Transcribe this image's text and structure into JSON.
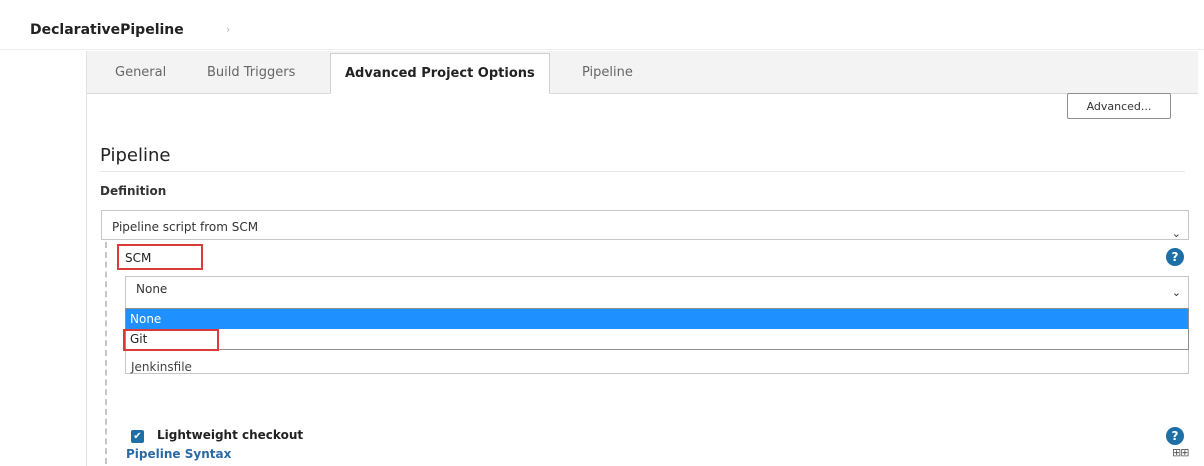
{
  "breadcrumb": {
    "project": "DeclarativePipeline",
    "arrow": "›"
  },
  "tabs": [
    {
      "label": "General"
    },
    {
      "label": "Build Triggers"
    },
    {
      "label": "Advanced Project Options"
    },
    {
      "label": "Pipeline"
    }
  ],
  "advanced_button": "Advanced...",
  "section": {
    "title": "Pipeline",
    "definition_label": "Definition",
    "definition_value": "Pipeline script from SCM"
  },
  "scm": {
    "label": "SCM",
    "selected": "None",
    "options": [
      "None",
      "Git"
    ],
    "script_path_value": "Jenkinsfile"
  },
  "lightweight_checkout": {
    "label": "Lightweight checkout",
    "checked": true
  },
  "pipeline_syntax_link": "Pipeline Syntax",
  "icons": {
    "help": "?",
    "chevron": "⌄",
    "checkmark": "✔",
    "grid": "⊞⊞"
  },
  "colors": {
    "accent": "#1d6fa5",
    "selection": "#1e90ff",
    "highlight_box": "#d93a3a"
  }
}
